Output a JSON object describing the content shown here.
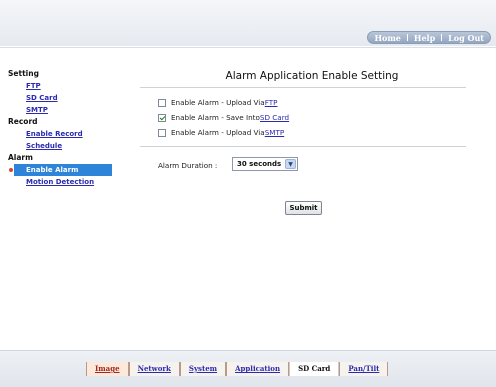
{
  "top_nav": {
    "home": "Home",
    "help": "Help",
    "logout": "Log Out"
  },
  "sidebar": {
    "setting_title": "Setting",
    "setting_items": [
      "FTP",
      "SD Card",
      "SMTP"
    ],
    "record_title": "Record",
    "record_items": [
      "Enable Record",
      "Schedule"
    ],
    "alarm_title": "Alarm",
    "alarm_items": [
      "Enable Alarm",
      "Motion Detection"
    ]
  },
  "main": {
    "title": "Alarm Application Enable Setting",
    "options": [
      {
        "prefix": "Enable Alarm - Upload Via ",
        "link": "FTP",
        "checked": false
      },
      {
        "prefix": "Enable Alarm - Save Into ",
        "link": "SD Card",
        "checked": true
      },
      {
        "prefix": "Enable Alarm - Upload Via ",
        "link": "SMTP",
        "checked": false
      }
    ],
    "duration_label": "Alarm Duration :",
    "duration_value": "30 seconds",
    "submit": "Submit"
  },
  "bottom_tabs": {
    "items": [
      "Image",
      "Network",
      "System",
      "Application",
      "SD Card",
      "Pan/Tilt"
    ],
    "active": "SD Card"
  }
}
